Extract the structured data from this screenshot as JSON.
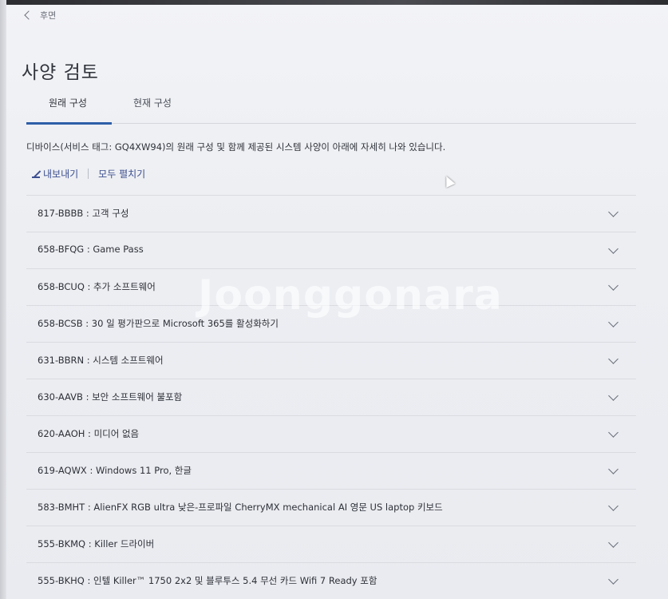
{
  "nav": {
    "back_label": "후면"
  },
  "page": {
    "title": "사양 검토"
  },
  "tabs": [
    {
      "label": "원래 구성",
      "active": true
    },
    {
      "label": "현재 구성",
      "active": false
    }
  ],
  "description": "디바이스(서비스 태그: GQ4XW94)의 원래 구성 및 함께 제공된 시스템 사양이 아래에 자세히 나와 있습니다.",
  "actions": {
    "export_label": "내보내기",
    "expand_all_label": "모두 펼치기"
  },
  "components": [
    {
      "label": "817-BBBB : 고객 구성"
    },
    {
      "label": "658-BFQG : Game Pass"
    },
    {
      "label": "658-BCUQ : 추가 소프트웨어"
    },
    {
      "label": "658-BCSB : 30 일 평가판으로 Microsoft 365를 활성화하기"
    },
    {
      "label": "631-BBRN : 시스템 소프트웨어"
    },
    {
      "label": "630-AAVB : 보안 소프트웨어 불포함"
    },
    {
      "label": "620-AAOH : 미디어 없음"
    },
    {
      "label": "619-AQWX : Windows 11 Pro, 한글"
    },
    {
      "label": "583-BMHT : AlienFX RGB ultra 낮은-프로파일 CherryMX mechanical AI 영문 US laptop 키보드"
    },
    {
      "label": "555-BKMQ : Killer 드라이버"
    },
    {
      "label": "555-BKHQ : 인텔 Killer™ 1750 2x2 및 블루투스 5.4 무선 카드 Wifi 7 Ready 포함"
    }
  ],
  "watermark": "Joonggonara",
  "colors": {
    "accent": "#2d5fa8",
    "link": "#3d4f8f"
  }
}
